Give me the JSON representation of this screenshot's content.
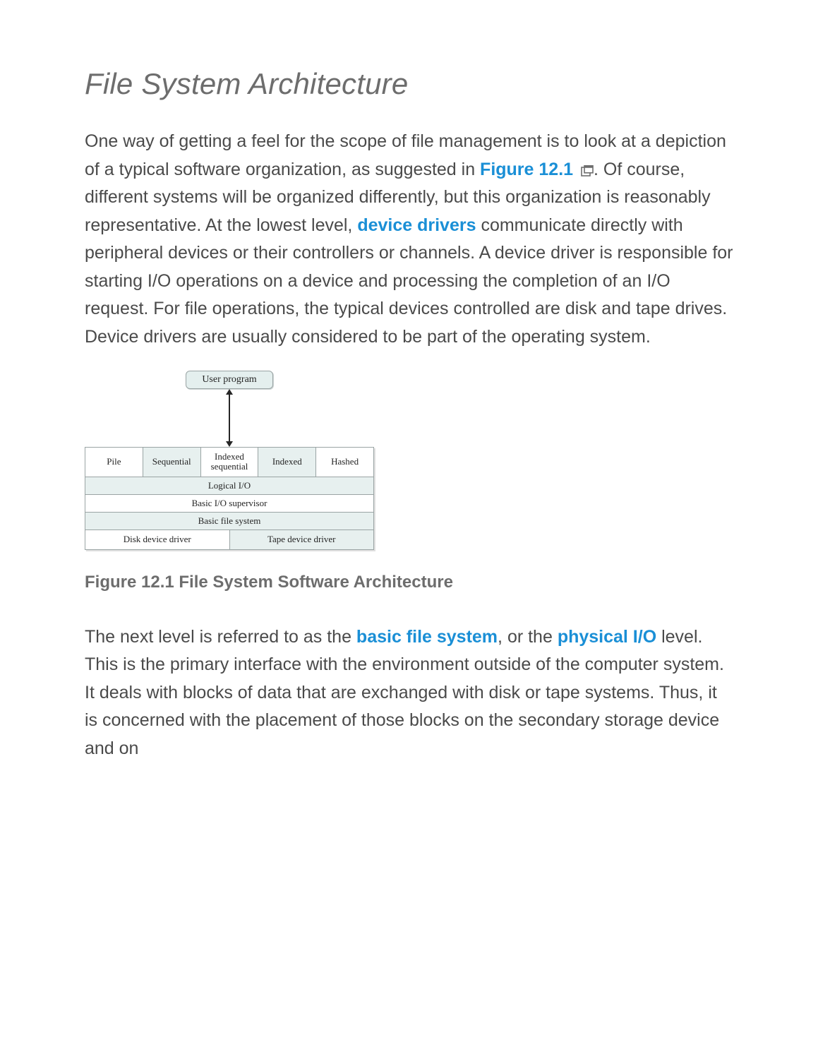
{
  "heading": "File System Architecture",
  "para1": {
    "t1": "One way of getting a feel for the scope of file management is to look at a depiction of a typical software organization, as suggested in ",
    "figure_link": "Figure 12.1",
    "t2": ". Of course, different systems will be organized differently, but this organization is reasonably representative. At the lowest level, ",
    "device_drivers_link": "device drivers",
    "t3": " communicate directly with peripheral devices or their controllers or channels. A device driver is responsible for starting I/O operations on a device and processing the completion of an I/O request. For file operations, the typical devices controlled are disk and tape drives. Device drivers are usually considered to be part of the operating system."
  },
  "diagram": {
    "user_program": "User program",
    "access_methods": [
      "Pile",
      "Sequential",
      "Indexed\nsequential",
      "Indexed",
      "Hashed"
    ],
    "layers": [
      "Logical I/O",
      "Basic I/O supervisor",
      "Basic file system"
    ],
    "drivers": [
      "Disk device driver",
      "Tape device driver"
    ]
  },
  "figure_caption": "Figure 12.1 File System Software Architecture",
  "para2": {
    "t1": "The next level is referred to as the ",
    "basic_fs_link": "basic file system",
    "t2": ", or the ",
    "physical_io_link": "physical I/O",
    "t3": " level. This is the primary interface with the environment outside of the computer system. It deals with blocks of data that are exchanged with disk or tape systems. Thus, it is concerned with the placement of those blocks on the secondary storage device and on"
  }
}
